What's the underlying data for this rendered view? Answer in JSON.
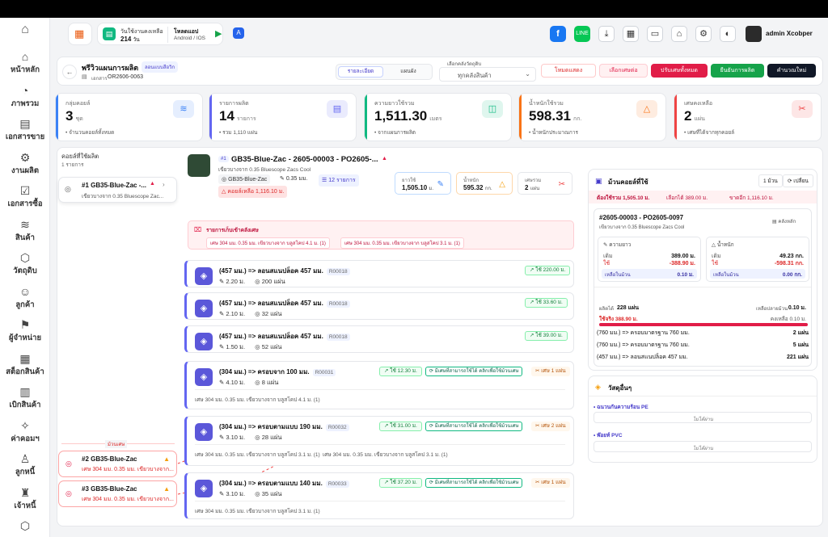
{
  "nav": {
    "items": [
      {
        "label": "หน้าหลัก",
        "icon": "home-icon"
      },
      {
        "label": "ภาพรวม",
        "icon": "chart-icon"
      },
      {
        "label": "เอกสารขาย",
        "icon": "document-icon"
      },
      {
        "label": "งานผลิต",
        "icon": "gear-icon"
      },
      {
        "label": "เอกสารซื้อ",
        "icon": "checklist-icon"
      },
      {
        "label": "สินค้า",
        "icon": "layers-icon"
      },
      {
        "label": "วัตถุดิบ",
        "icon": "box-icon"
      },
      {
        "label": "ลูกค้า",
        "icon": "customer-icon"
      },
      {
        "label": "ผู้จำหน่าย",
        "icon": "supplier-icon"
      },
      {
        "label": "สต็อกสินค้า",
        "icon": "warehouse-icon"
      },
      {
        "label": "เบิกสินค้า",
        "icon": "withdraw-icon"
      },
      {
        "label": "ค่าคอมฯ",
        "icon": "commission-icon"
      },
      {
        "label": "ลูกหนี้",
        "icon": "debtor-icon"
      },
      {
        "label": "เจ้าหนี้",
        "icon": "creditor-icon"
      },
      {
        "label": "",
        "icon": "more-box-icon"
      }
    ]
  },
  "topbar": {
    "days_label": "วันใช้งานคงเหลือ",
    "days_value": "214",
    "days_unit": "วัน",
    "download_label": "โหลดแอป",
    "download_sub": "Android / IOS",
    "user_name": "admin Xcobper"
  },
  "header": {
    "title": "พรีวิวแผนการผลิต",
    "badge": "ลอนแบบสีอวิก",
    "doc_label": "เอกสาร",
    "doc_no": "OR2606-0063",
    "view_list": "รายละเอียด",
    "view_map": "แผนผัง",
    "warehouse_label": "เลือกคลังวัตถุดิบ",
    "warehouse_value": "ทุกคลังสินค้า",
    "btn_preview": "โหมดแสดง",
    "btn_scrap": "เลือกเศษต่อ",
    "btn_cancel": "ปรับเศษทั้งหมด",
    "btn_confirm": "ยืนยันการผลิต",
    "btn_calc": "คำนวณใหม่"
  },
  "stats": [
    {
      "title": "กลุ่มคอยล์",
      "value": "3",
      "unit": "ชุด",
      "sub": "จำนวนคอยล์ทั้งหมด",
      "color": "#3b82f6",
      "icon": "stack-icon"
    },
    {
      "title": "รายการผลิต",
      "value": "14",
      "unit": "รายการ",
      "sub": "รวม 1,110 แผ่น",
      "color": "#6366f1",
      "icon": "file-icon"
    },
    {
      "title": "ความยาวใช้รวม",
      "value": "1,511.30",
      "unit": "เมตร",
      "sub": "จากแผนการผลิต",
      "color": "#10b981",
      "icon": "ruler-icon"
    },
    {
      "title": "น้ำหนักใช้รวม",
      "value": "598.31",
      "unit": "กก.",
      "sub": "น้ำหนักประมาณการ",
      "color": "#f97316",
      "icon": "weight-icon"
    },
    {
      "title": "เศษคงเหลือ",
      "value": "2",
      "unit": "แผ่น",
      "sub": "เศษที่ได้จากทุกคอยล์",
      "color": "#ef4444",
      "icon": "scissors-icon"
    }
  ],
  "left": {
    "title": "คอยล์ที่ใช้ผลิต",
    "count": "1 รายการ",
    "coil1_name": "#1 GB35-Blue-Zac -...",
    "coil1_desc": "เขียวบางจาก 0.35 Bluescope Zac...",
    "scrap_divider": "ม้วนเศษ",
    "coil2_name": "#2 GB35-Blue-Zac",
    "coil2_desc": "เศษ 304 มม. 0.35 มม. เขียวบางจาก...",
    "coil3_name": "#3 GB35-Blue-Zac",
    "coil3_desc": "เศษ 304 มม. 0.35 มม. เขียวบางจาก..."
  },
  "coil_head": {
    "index": "#1",
    "name": "GB35-Blue-Zac - 2605-00003 - PO2605-...",
    "desc": "เขียวบางจาก 0.35 Bluescope Zacs Cool",
    "tag_code": "GB35-Blue-Zac",
    "tag_thick": "0.35 มม.",
    "tag_items": "12 รายการ",
    "tag_remain": "คอยล์เหลือ 1,116.10 ม.",
    "len_label": "ยาวใช้",
    "len_value": "1,505.10",
    "len_unit": "ม.",
    "wt_label": "น้ำหนัก",
    "wt_value": "595.32",
    "wt_unit": "กก.",
    "scrap_label": "เศษรวม",
    "scrap_value": "2",
    "scrap_unit": "แผ่น"
  },
  "scrap_box": {
    "title": "รายการเก็บเข้าคลังเศษ",
    "chip1": "เศษ 304 มม. 0.35 มม. เขียวบางจาก บลูสโคป 4.1 ม. (1)",
    "chip2": "เศษ 304 มม. 0.35 มม. เขียวบางจาก บลูสโคป 3.1 ม. (1)"
  },
  "rows": [
    {
      "name": "(457 มม.) => ลอนสแนปล็อค 457 มม.",
      "code": "R00018",
      "len": "2.20 ม.",
      "qty": "200 แผ่น",
      "used": "ใช้ 220.00 ม."
    },
    {
      "name": "(457 มม.) => ลอนสแนปล็อค 457 มม.",
      "code": "R00018",
      "len": "2.10 ม.",
      "qty": "32 แผ่น",
      "used": "ใช้ 33.60 ม."
    },
    {
      "name": "(457 มม.) => ลอนสแนปล็อค 457 มม.",
      "code": "R00018",
      "len": "1.50 ม.",
      "qty": "52 แผ่น",
      "used": "ใช้ 39.00 ม."
    },
    {
      "name": "(304 มม.) => ครอบจาก 100 มม.",
      "code": "R00031",
      "len": "4.10 ม.",
      "qty": "8 แผ่น",
      "used": "ใช้ 12.30 ม.",
      "link": "มีเศษที่สามารถใช้ได้ คลิกเพื่อใช้ม้วนเศษ",
      "scrap": "เศษ 1 แผ่น",
      "note": "เศษ 304 มม. 0.35 มม. เขียวบางจาก บลูสโคป 4.1 ม. (1)"
    },
    {
      "name": "(304 มม.) => ครอบตามแบบ 190 มม.",
      "code": "R00032",
      "len": "3.10 ม.",
      "qty": "28 แผ่น",
      "used": "ใช้ 31.00 ม.",
      "link": "มีเศษที่สามารถใช้ได้ คลิกเพื่อใช้ม้วนเศษ",
      "scrap": "เศษ 2 แผ่น",
      "note": "เศษ 304 มม. 0.35 มม. เขียวบางจาก บลูสโคป 3.1 ม. (1)",
      "note2": "เศษ 304 มม. 0.35 มม. เขียวบางจาก บลูสโคป 3.1 ม. (1)"
    },
    {
      "name": "(304 มม.) => ครอบตามแบบ 140 มม.",
      "code": "R00033",
      "len": "3.10 ม.",
      "qty": "35 แผ่น",
      "used": "ใช้ 37.20 ม.",
      "link": "มีเศษที่สามารถใช้ได้ คลิกเพื่อใช้ม้วนเศษ",
      "scrap": "เศษ 1 แผ่น",
      "note": "เศษ 304 มม. 0.35 มม. เขียวบางจาก บลูสโคป 3.1 ม. (1)"
    }
  ],
  "right": {
    "title": "ม้วนคอยล์ที่ใช้",
    "count_btn": "1 ม้วน",
    "switch_btn": "เปลี่ยน",
    "need": "ต้องใช้รวม 1,505.10 ม.",
    "selected": "เลือกได้ 389.00 ม.",
    "lack": "ขาดอีก 1,116.10 ม.",
    "roll_no": "#2605-00003 - PO2605-0097",
    "roll_desc": "เขียวบางจาก 0.35 Bluescope Zacs Cool",
    "warehouse": "คลังหลัก",
    "len_title": "ความยาว",
    "len_start_label": "เดิม",
    "len_start": "389.00 ม.",
    "len_use_label": "ใช้",
    "len_use": "-388.90 ม.",
    "len_left_label": "เหลือในม้วน",
    "len_left": "0.10 ม.",
    "wt_title": "น้ำหนัก",
    "wt_start_label": "เดิม",
    "wt_start": "49.23 กก.",
    "wt_use_label": "ใช้",
    "wt_use": "-598.31 กก.",
    "wt_left_label": "เหลือในม้วน",
    "wt_left": "0.00 กก.",
    "produced_label": "ผลิตได้",
    "produced": "228 แผ่น",
    "remain_label": "เหลือปลายม้วน",
    "remain": "0.10 ม.",
    "used_total": "ใช้จริง 388.90 ม.",
    "leftover": "คงเหลือ 0.10 ม.",
    "progress": 0.9997,
    "pieces": [
      {
        "name": "(760 มม.) => ครอบมาตรฐาน 760 มม.",
        "qty": "2 แผ่น"
      },
      {
        "name": "(760 มม.) => ครอบมาตรฐาน 760 มม.",
        "qty": "5 แผ่น"
      },
      {
        "name": "(457 มม.) => ลอนสแนปล็อค 457 มม.",
        "qty": "221 แผ่น"
      }
    ],
    "other_title": "วัสดุอื่นๆ",
    "other1": "ฉนวนกันความร้อน PE",
    "other1_state": "ไม่ได้ผ่าน",
    "other2": "พ๊อยท์ PVC",
    "other2_state": "ไม่ได้ผ่าน"
  }
}
